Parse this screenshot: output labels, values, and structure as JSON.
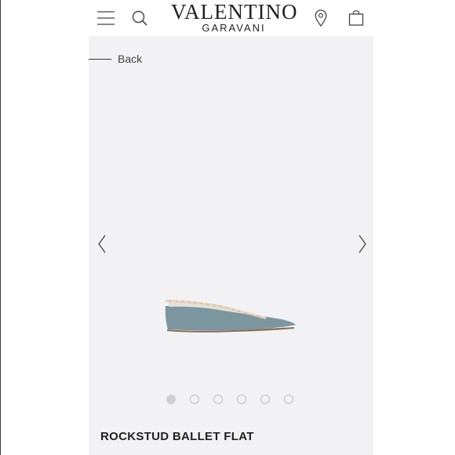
{
  "header": {
    "brand_main": "VALENTINO",
    "brand_sub": "GARAVANI",
    "icons": [
      "menu-icon",
      "search-icon",
      "store-locator-icon",
      "shopping-bag-icon"
    ]
  },
  "nav": {
    "back_label": "Back"
  },
  "gallery": {
    "icons": [
      "chevron-left-icon",
      "chevron-right-icon"
    ],
    "image_count": 6,
    "active_index": 0
  },
  "product": {
    "title": "ROCKSTUD BALLET FLAT"
  },
  "colors": {
    "page_background": "#ffffff",
    "app_background": "#f2f2f4",
    "header_background": "#ffffff",
    "text": "#222222",
    "shoe_body": "#7c96a0",
    "stud_trim": "#e9d3bd"
  }
}
